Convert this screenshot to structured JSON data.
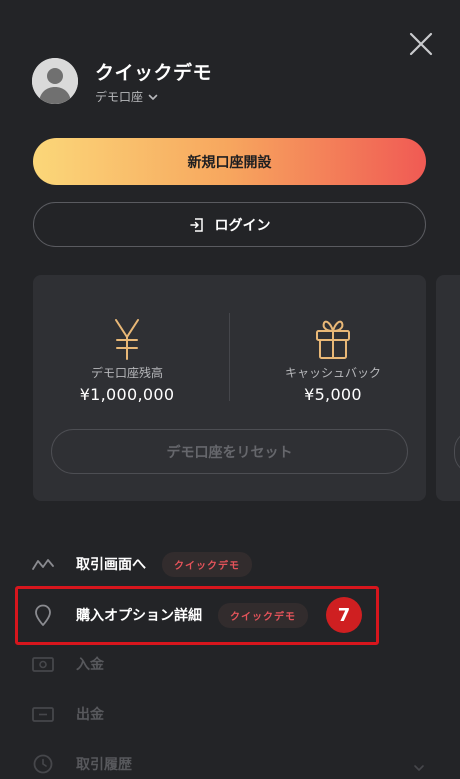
{
  "header": {
    "account_name": "クイックデモ",
    "account_type": "デモ口座"
  },
  "buttons": {
    "open_account": "新規口座開設",
    "login": "ログイン"
  },
  "balance_card": {
    "balance_label": "デモ口座残高",
    "balance_value": "¥1,000,000",
    "cashback_label": "キャッシュバック",
    "cashback_value": "¥5,000",
    "reset_label": "デモ口座をリセット"
  },
  "menu": {
    "items": [
      {
        "label": "取引画面へ",
        "tag": "クイックデモ",
        "icon": "chart-line-icon"
      },
      {
        "label": "購入オプション詳細",
        "tag": "クイックデモ",
        "icon": "location-pin-icon"
      },
      {
        "label": "入金",
        "icon": "deposit-icon"
      },
      {
        "label": "出金",
        "icon": "withdraw-icon"
      },
      {
        "label": "取引履歴",
        "icon": "history-icon"
      }
    ]
  },
  "annotation": {
    "step_number": "7"
  },
  "colors": {
    "background": "#232427",
    "card": "#2f3034",
    "gold_icon": "#e9b877",
    "tag_text": "#e4535a",
    "highlight": "#d7161d",
    "gradient_start": "#fbd779",
    "gradient_end": "#f05a54"
  }
}
